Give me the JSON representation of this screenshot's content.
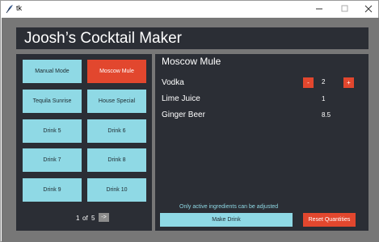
{
  "window": {
    "title": "tk"
  },
  "app": {
    "title": "Joosh’s Cocktail Maker"
  },
  "drinks": {
    "buttons": [
      {
        "label": "Manual Mode"
      },
      {
        "label": "Moscow Mule",
        "active": true
      },
      {
        "label": "Tequila Sunrise"
      },
      {
        "label": "House Special"
      },
      {
        "label": "Drink 5"
      },
      {
        "label": "Drink 6"
      },
      {
        "label": "Drink 7"
      },
      {
        "label": "Drink 8"
      },
      {
        "label": "Drink 9"
      },
      {
        "label": "Drink 10"
      }
    ],
    "pager": {
      "current": "1",
      "of": "of",
      "total": "5",
      "next_label": "->"
    }
  },
  "detail": {
    "drink_name": "Moscow Mule",
    "ingredients": [
      {
        "name": "Vodka",
        "quantity": "2",
        "adjustable": true
      },
      {
        "name": "Lime Juice",
        "quantity": "1",
        "adjustable": false
      },
      {
        "name": "Ginger Beer",
        "quantity": "8.5",
        "adjustable": false
      }
    ],
    "decrease_label": "-",
    "increase_label": "+",
    "note": "Only active ingredients can be adjusted",
    "make_label": "Make Drink",
    "reset_label": "Reset Quantities"
  },
  "colors": {
    "panel_bg": "#2b2e35",
    "frame_bg": "#777777",
    "accent_cyan": "#8fd9e5",
    "accent_red": "#e2472e"
  }
}
